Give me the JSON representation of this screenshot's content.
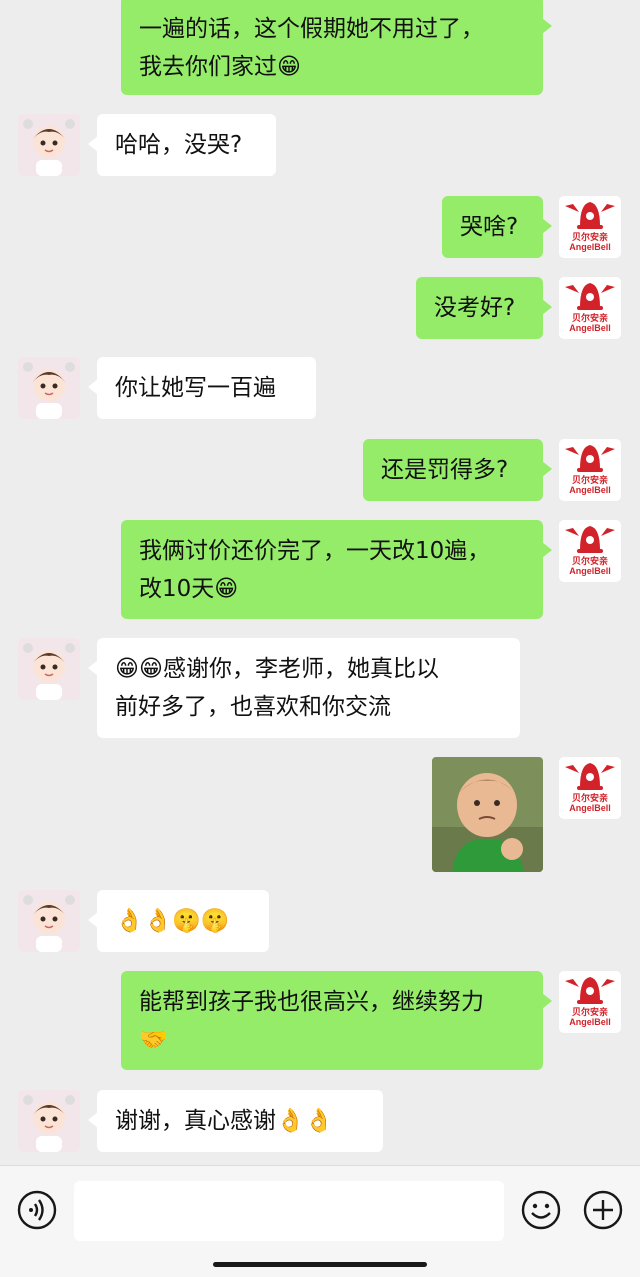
{
  "messages": [
    {
      "id": 0,
      "side": "mine",
      "text": "一遍的话，这个假期她不用过了，\n我去你们家过😁"
    },
    {
      "id": 1,
      "side": "theirs",
      "text": "哈哈，没哭?"
    },
    {
      "id": 2,
      "side": "mine",
      "text": "哭啥?"
    },
    {
      "id": 3,
      "side": "mine",
      "text": "没考好?"
    },
    {
      "id": 4,
      "side": "theirs",
      "text": "你让她写一百遍"
    },
    {
      "id": 5,
      "side": "mine",
      "text": "还是罚得多?"
    },
    {
      "id": 6,
      "side": "mine",
      "text": "我俩讨价还价完了，一天改10遍，\n改10天😁"
    },
    {
      "id": 7,
      "side": "theirs",
      "text": "😁😁感谢你，李老师，她真比以\n前好多了，也喜欢和你交流"
    },
    {
      "id": 8,
      "side": "mine",
      "sticker": "success-kid-sticker"
    },
    {
      "id": 9,
      "side": "theirs",
      "text": "👌👌🤫🤫"
    },
    {
      "id": 10,
      "side": "mine",
      "text": "能帮到孩子我也很高兴，继续努力\n🤝"
    },
    {
      "id": 11,
      "side": "theirs",
      "text": "谢谢，真心感谢👌👌"
    }
  ],
  "avatars": {
    "mine": {
      "brand_cn": "贝尔安亲",
      "brand_en": "AngelBell",
      "color": "#d2232a"
    },
    "theirs": {
      "icon": "cartoon-boy-avatar"
    }
  },
  "input_bar": {
    "voice_icon": "voice-icon",
    "input_value": "",
    "emoji_icon": "emoji-icon",
    "plus_icon": "plus-icon"
  },
  "colors": {
    "mine_bubble": "#95ec69",
    "theirs_bubble": "#ffffff",
    "background": "#ededed"
  }
}
